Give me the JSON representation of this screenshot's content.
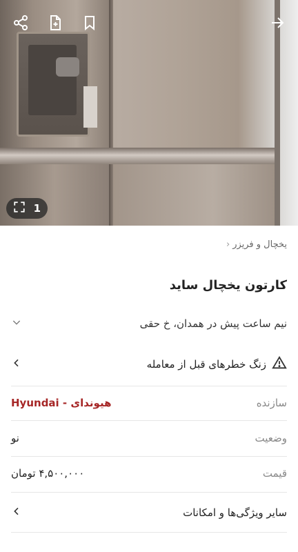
{
  "hero": {
    "image_count": "1",
    "icons": {
      "share": "share-icon",
      "note": "note-add-icon",
      "bookmark": "bookmark-icon",
      "back": "arrow-right-icon",
      "fullscreen": "fullscreen-icon"
    }
  },
  "breadcrumb": {
    "category": "یخچال و فریزر"
  },
  "ad": {
    "title": "کارتون یخچال ساید",
    "meta": "نیم ساعت پیش در همدان، خ حقی"
  },
  "warning": {
    "label": "زنگ خطرهای قبل از معامله"
  },
  "attributes": [
    {
      "key": "سازنده",
      "value": "هیوندای - Hyundai"
    },
    {
      "key": "وضعیت",
      "value": "نو"
    },
    {
      "key": "قیمت",
      "value": "۴,۵۰۰,۰۰۰ تومان"
    }
  ],
  "more": {
    "label": "سایر ویژگی‌ها و امکانات"
  },
  "colors": {
    "brand_value": "#a62626",
    "muted_text": "#888888",
    "separator": "#e6e6e6"
  }
}
